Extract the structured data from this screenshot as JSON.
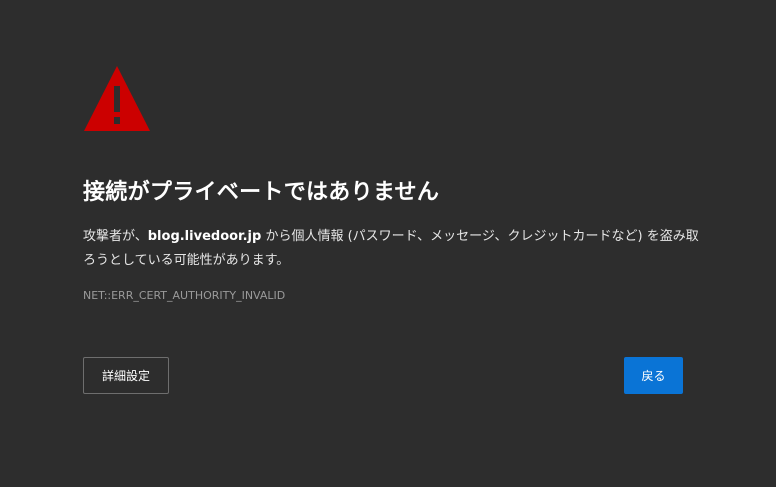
{
  "icon": {
    "name": "warning-triangle-icon",
    "color": "#cc0000"
  },
  "title": "接続がプライベートではありません",
  "message": {
    "prefix": "攻撃者が、",
    "domain": "blog.livedoor.jp",
    "suffix": " から個人情報 (パスワード、メッセージ、クレジットカードなど) を盗み取ろうとしている可能性があります。"
  },
  "error_code": "NET::ERR_CERT_AUTHORITY_INVALID",
  "buttons": {
    "advanced_label": "詳細設定",
    "back_label": "戻る"
  },
  "colors": {
    "background": "#2d2d2d",
    "primary_button": "#0a74d6"
  }
}
